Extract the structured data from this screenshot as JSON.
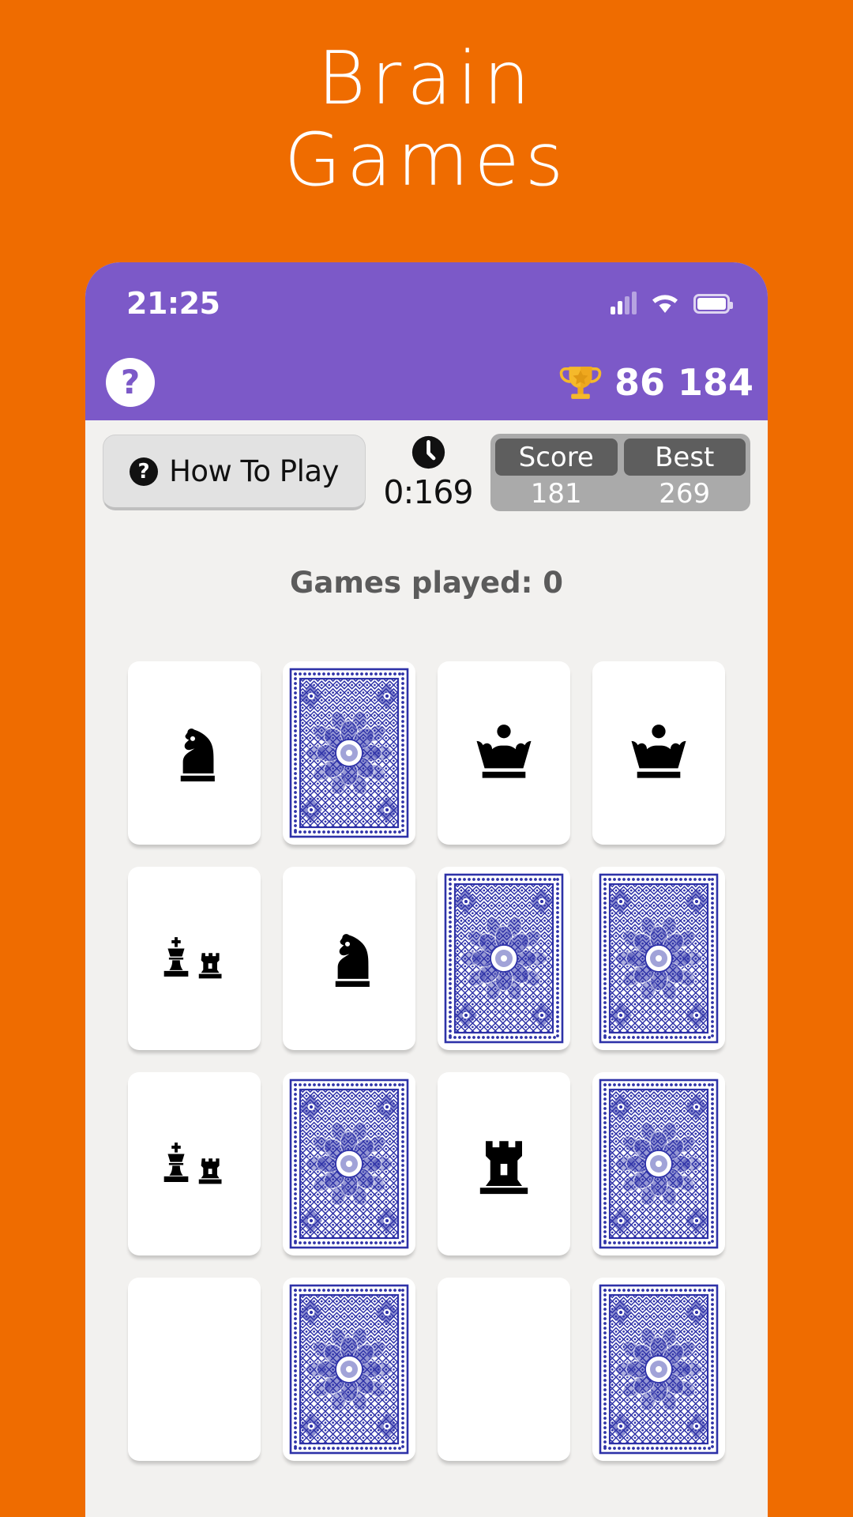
{
  "banner": {
    "line1": "Brain",
    "line2": "Games",
    "background_color": "#EF6C00",
    "text_color": "#FFFFFF"
  },
  "phone": {
    "status_bar": {
      "time": "21:25",
      "background_color": "#7C59C8",
      "icons": [
        "signal-icon",
        "wifi-icon",
        "battery-icon"
      ]
    },
    "app_header": {
      "help_button_label": "?",
      "trophy_icon": "trophy-icon",
      "trophy_score": "86 184",
      "background_color": "#7C59C8"
    },
    "toolbar": {
      "how_to_play_label": "How To Play",
      "how_to_play_icon": "question-mark-icon",
      "timer_icon": "clock-icon",
      "timer_value": "0:169",
      "score_caption": "Score",
      "score_value": "181",
      "best_caption": "Best",
      "best_value": "269"
    },
    "status_text": "Games played: 0",
    "grid": {
      "columns": 4,
      "card_back_color": "#2E32A8",
      "cards": [
        {
          "state": "face",
          "piece": "knight-icon"
        },
        {
          "state": "back",
          "piece": "card-back"
        },
        {
          "state": "face",
          "piece": "queen-crown-icon"
        },
        {
          "state": "face",
          "piece": "queen-crown-icon"
        },
        {
          "state": "face",
          "piece": "king-rook-castling-icon"
        },
        {
          "state": "face",
          "piece": "knight-icon"
        },
        {
          "state": "back",
          "piece": "card-back"
        },
        {
          "state": "back",
          "piece": "card-back"
        },
        {
          "state": "face",
          "piece": "king-rook-castling-icon"
        },
        {
          "state": "back",
          "piece": "card-back"
        },
        {
          "state": "face",
          "piece": "rook-icon"
        },
        {
          "state": "back",
          "piece": "card-back"
        },
        {
          "state": "face",
          "piece": "blank-icon"
        },
        {
          "state": "back",
          "piece": "card-back"
        },
        {
          "state": "face",
          "piece": "blank-icon"
        },
        {
          "state": "back",
          "piece": "card-back"
        }
      ]
    }
  }
}
